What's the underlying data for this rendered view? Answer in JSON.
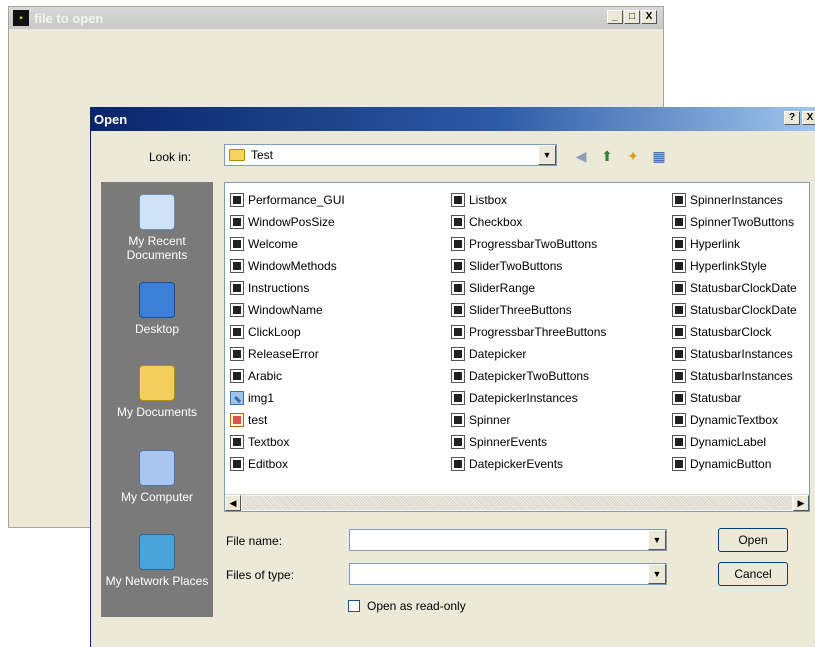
{
  "bg_window": {
    "title": "file to open",
    "controls": [
      "_",
      "□",
      "X"
    ]
  },
  "dialog": {
    "title": "Open",
    "controls": [
      "?",
      "X"
    ],
    "look_in": {
      "label": "Look in:",
      "value": "Test"
    },
    "toolbar_icons": [
      "back-icon",
      "up-folder-icon",
      "new-folder-icon",
      "views-menu-icon"
    ],
    "places": [
      {
        "label": "My Recent Documents",
        "icon": "recent-documents-icon"
      },
      {
        "label": "Desktop",
        "icon": "desktop-icon"
      },
      {
        "label": "My Documents",
        "icon": "my-documents-icon"
      },
      {
        "label": "My Computer",
        "icon": "my-computer-icon"
      },
      {
        "label": "My Network Places",
        "icon": "network-places-icon"
      }
    ],
    "files": {
      "col1": [
        {
          "name": "Performance_GUI",
          "kind": "exe"
        },
        {
          "name": "WindowPosSize",
          "kind": "exe"
        },
        {
          "name": "Welcome",
          "kind": "exe"
        },
        {
          "name": "WindowMethods",
          "kind": "exe"
        },
        {
          "name": "Instructions",
          "kind": "exe"
        },
        {
          "name": "WindowName",
          "kind": "exe"
        },
        {
          "name": "ClickLoop",
          "kind": "exe"
        },
        {
          "name": "ReleaseError",
          "kind": "exe"
        },
        {
          "name": "Arabic",
          "kind": "exe"
        },
        {
          "name": "img1",
          "kind": "img"
        },
        {
          "name": "test",
          "kind": "txt"
        },
        {
          "name": "Textbox",
          "kind": "exe"
        },
        {
          "name": "Editbox",
          "kind": "exe"
        }
      ],
      "col2": [
        {
          "name": "Listbox",
          "kind": "exe"
        },
        {
          "name": "Checkbox",
          "kind": "exe"
        },
        {
          "name": "ProgressbarTwoButtons",
          "kind": "exe"
        },
        {
          "name": "SliderTwoButtons",
          "kind": "exe"
        },
        {
          "name": "SliderRange",
          "kind": "exe"
        },
        {
          "name": "SliderThreeButtons",
          "kind": "exe"
        },
        {
          "name": "ProgressbarThreeButtons",
          "kind": "exe"
        },
        {
          "name": "Datepicker",
          "kind": "exe"
        },
        {
          "name": "DatepickerTwoButtons",
          "kind": "exe"
        },
        {
          "name": "DatepickerInstances",
          "kind": "exe"
        },
        {
          "name": "Spinner",
          "kind": "exe"
        },
        {
          "name": "SpinnerEvents",
          "kind": "exe"
        },
        {
          "name": "DatepickerEvents",
          "kind": "exe"
        }
      ],
      "col3": [
        {
          "name": "SpinnerInstances",
          "kind": "exe"
        },
        {
          "name": "SpinnerTwoButtons",
          "kind": "exe"
        },
        {
          "name": "Hyperlink",
          "kind": "exe"
        },
        {
          "name": "HyperlinkStyle",
          "kind": "exe"
        },
        {
          "name": "StatusbarClockDate",
          "kind": "exe"
        },
        {
          "name": "StatusbarClockDate",
          "kind": "exe"
        },
        {
          "name": "StatusbarClock",
          "kind": "exe"
        },
        {
          "name": "StatusbarInstances",
          "kind": "exe"
        },
        {
          "name": "StatusbarInstances",
          "kind": "exe"
        },
        {
          "name": "Statusbar",
          "kind": "exe"
        },
        {
          "name": "DynamicTextbox",
          "kind": "exe"
        },
        {
          "name": "DynamicLabel",
          "kind": "exe"
        },
        {
          "name": "DynamicButton",
          "kind": "exe"
        }
      ]
    },
    "file_name": {
      "label": "File name:",
      "value": ""
    },
    "files_of_type": {
      "label": "Files of type:",
      "value": ""
    },
    "read_only": {
      "label": "Open as read-only",
      "checked": false
    },
    "open_button": "Open",
    "cancel_button": "Cancel"
  }
}
